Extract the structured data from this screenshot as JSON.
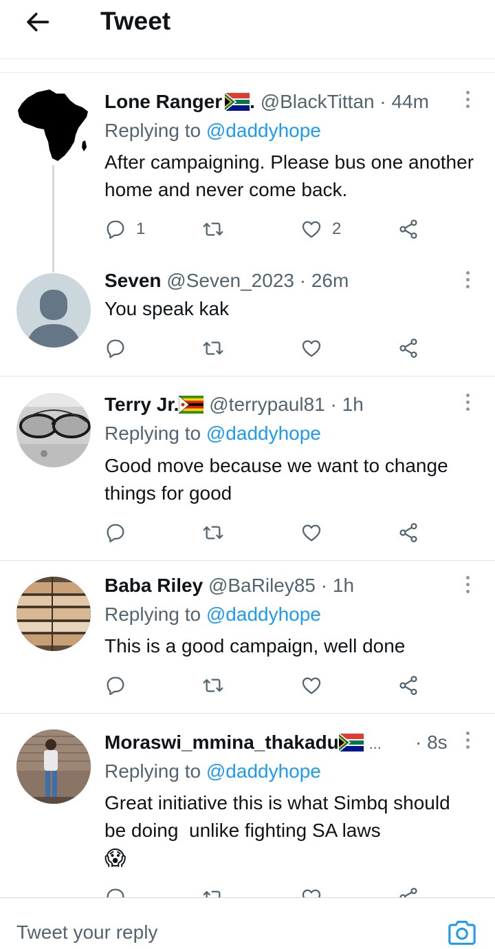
{
  "header": {
    "title": "Tweet"
  },
  "tweets": [
    {
      "name": "Lone Ranger",
      "name_suffix": ".",
      "handle": "@BlackTittan",
      "time": "· 44m",
      "replying_prefix": "Replying to",
      "replying_to": "@daddyhope",
      "text": "After campaigning. Please bus one another home and never come back.",
      "reply_count": "1",
      "retweet_count": "",
      "like_count": "2"
    },
    {
      "name": "Seven",
      "handle": "@Seven_2023",
      "time": "· 26m",
      "text": "You speak kak",
      "reply_count": "",
      "retweet_count": "",
      "like_count": ""
    },
    {
      "name": "Terry Jr.",
      "handle": "@terrypaul81",
      "time": "· 1h",
      "replying_prefix": "Replying to",
      "replying_to": "@daddyhope",
      "text": "Good move because we want to change things for good"
    },
    {
      "name": "Baba Riley",
      "handle": "@BaRiley85",
      "time": "· 1h",
      "replying_prefix": "Replying to",
      "replying_to": "@daddyhope",
      "text": "This is a good campaign, well done"
    },
    {
      "name": "Moraswi_mmina_thakadu",
      "handle": "...",
      "time": "· 8s",
      "replying_prefix": "Replying to",
      "replying_to": "@daddyhope",
      "text": "Great initiative this is what Simbq should  be doing  unlike fighting SA laws",
      "emoji": "😱"
    }
  ],
  "composer": {
    "placeholder": "Tweet your reply"
  },
  "icons": {
    "back": "arrow-left-icon",
    "more": "more-vertical-icon",
    "reply": "reply-bubble-icon",
    "retweet": "retweet-icon",
    "like": "heart-icon",
    "share": "share-icon",
    "camera": "camera-icon",
    "flag_za": "south-africa-flag-icon",
    "flag_zw": "zimbabwe-flag-icon"
  },
  "colors": {
    "accent": "#1d9bf0",
    "muted": "#536471",
    "text": "#0f1419",
    "divider": "#e6ecf0"
  }
}
